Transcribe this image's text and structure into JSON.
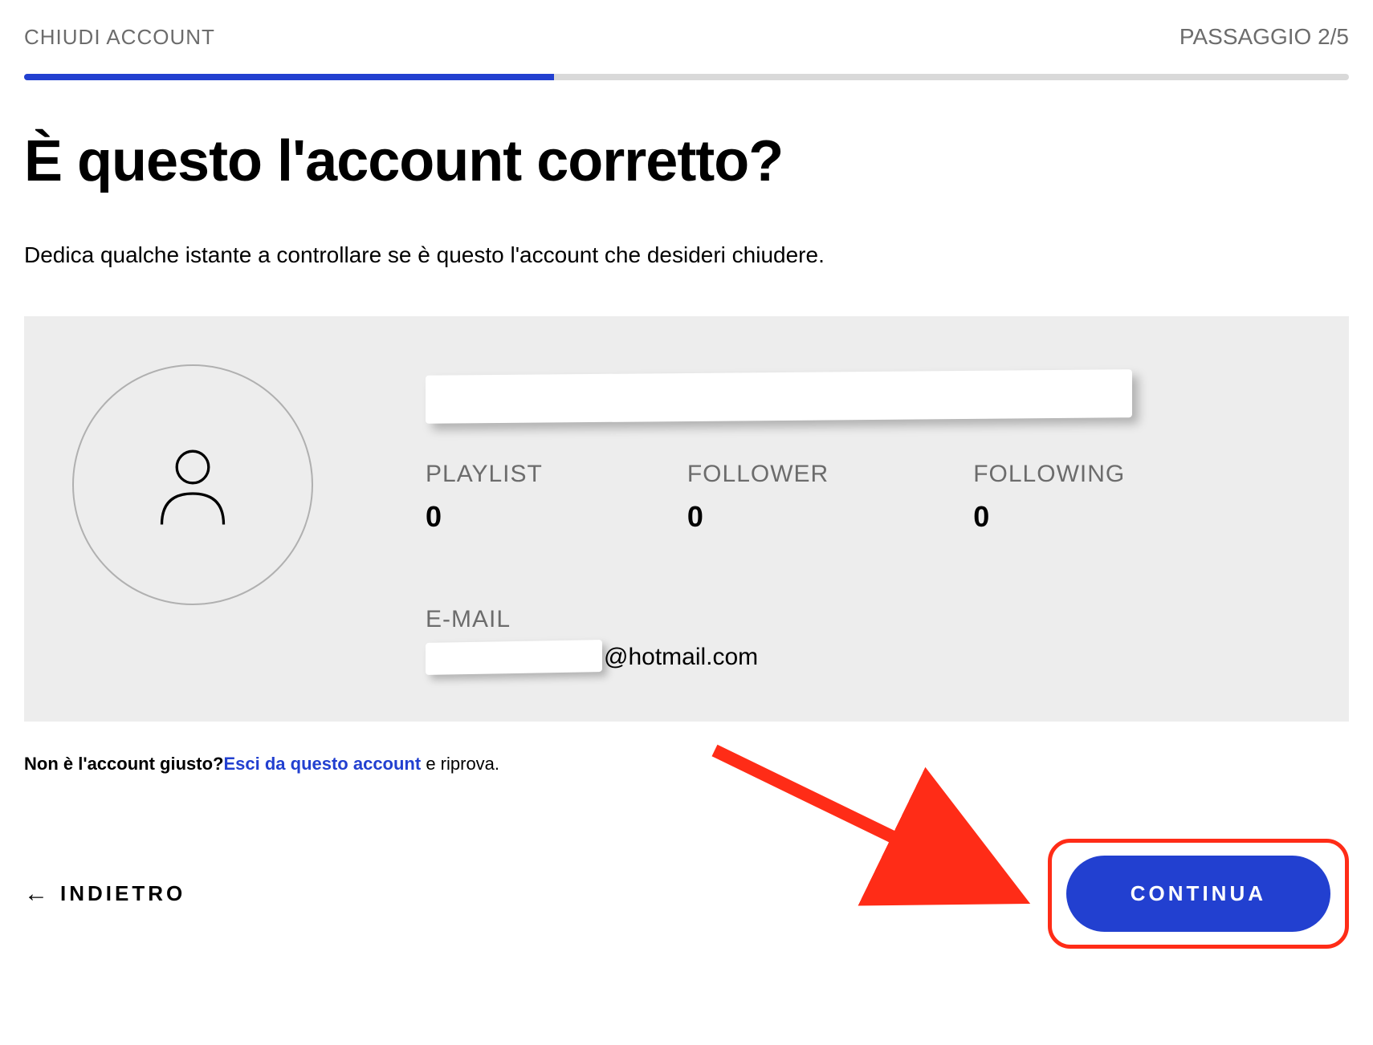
{
  "header": {
    "title": "CHIUDI ACCOUNT",
    "step_label": "PASSAGGIO 2/5"
  },
  "progress": {
    "percent": 40
  },
  "main": {
    "title": "È questo l'account corretto?",
    "subtitle": "Dedica qualche istante a controllare se è questo l'account che desideri chiudere."
  },
  "account": {
    "stats": {
      "playlist": {
        "label": "PLAYLIST",
        "value": "0"
      },
      "follower": {
        "label": "FOLLOWER",
        "value": "0"
      },
      "following": {
        "label": "FOLLOWING",
        "value": "0"
      }
    },
    "email": {
      "label": "E-MAIL",
      "domain": "@hotmail.com"
    }
  },
  "wrong_account": {
    "prefix": "Non è l'account giusto?",
    "link": "Esci da questo account",
    "suffix": " e riprova."
  },
  "footer": {
    "back_label": "INDIETRO",
    "continue_label": "CONTINUA"
  }
}
